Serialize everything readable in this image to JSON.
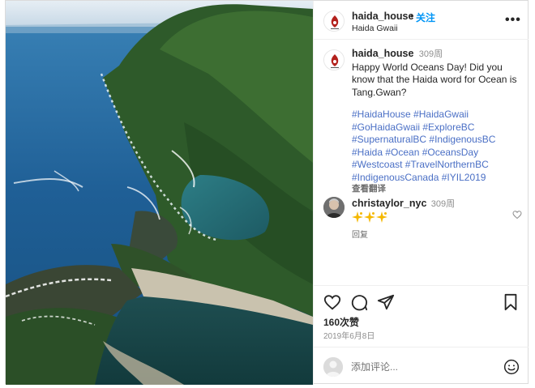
{
  "post": {
    "username": "haida_house",
    "follow_label": "关注",
    "separator": "•",
    "location": "Haida Gwaii",
    "more_label": "•••"
  },
  "caption": {
    "username": "haida_house",
    "time": "309周",
    "text": "Happy World Oceans Day! Did you know that the Haida word for Ocean is Tang.Gwan?",
    "hashtag_lines": [
      "#HaidaHouse #HaidaGwaii",
      "#GoHaidaGwaii #ExploreBC",
      "#SupernaturalBC #IndigenousBC",
      "#Haida #Ocean #OceansDay",
      "#Westcoast #TravelNorthernBC",
      "#IndigenousCanada #IYIL2019"
    ],
    "translate_label": "查看翻译"
  },
  "comment": {
    "username": "christaylor_nyc",
    "time": "309周",
    "reply_label": "回复"
  },
  "stats": {
    "likes": "160次赞",
    "date": "2019年6月8日"
  },
  "add_comment": {
    "placeholder": "添加评论..."
  },
  "colors": {
    "accent": "#0095f6",
    "hashtag": "#4a6fc5",
    "secondary_text": "#8e8e8e",
    "logo_red": "#b3211c"
  },
  "icons": [
    "more-icon",
    "heart-icon",
    "comment-icon",
    "share-icon",
    "bookmark-icon",
    "smile-icon",
    "sparkle-icon"
  ]
}
